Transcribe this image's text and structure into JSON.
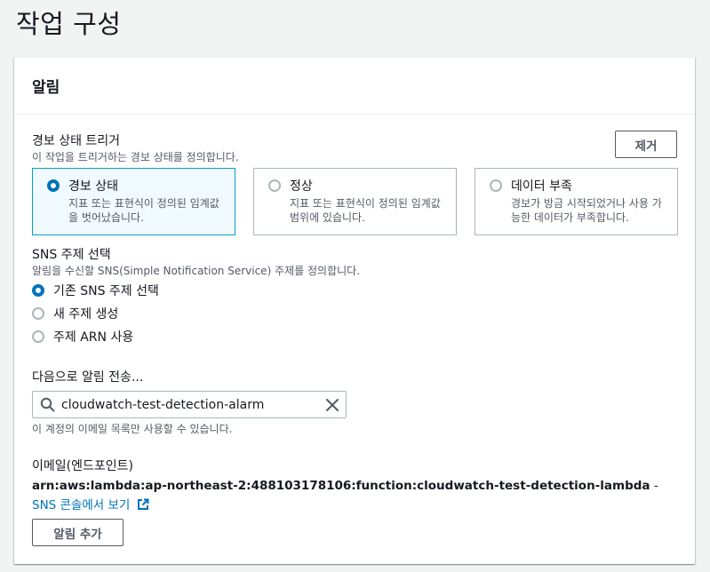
{
  "page": {
    "title": "작업 구성"
  },
  "panel": {
    "title": "알림",
    "remove_label": "제거"
  },
  "trigger": {
    "label": "경보 상태 트리거",
    "description": "이 작업을 트리거하는 경보 상태를 정의합니다.",
    "options": [
      {
        "title": "경보 상태",
        "desc": "지표 또는 표현식이 정의된 임계값을 벗어났습니다.",
        "selected": true
      },
      {
        "title": "정상",
        "desc": "지표 또는 표현식이 정의된 임계값 범위에 있습니다.",
        "selected": false
      },
      {
        "title": "데이터 부족",
        "desc": "경보가 방금 시작되었거나 사용 가능한 데이터가 부족합니다.",
        "selected": false
      }
    ]
  },
  "sns": {
    "label": "SNS 주제 선택",
    "description": "알림을 수신할 SNS(Simple Notification Service) 주제를 정의합니다.",
    "options": [
      {
        "label": "기존 SNS 주제 선택",
        "selected": true
      },
      {
        "label": "새 주제 생성",
        "selected": false
      },
      {
        "label": "주제 ARN 사용",
        "selected": false
      }
    ]
  },
  "send_to": {
    "label": "다음으로 알림 전송...",
    "value": "cloudwatch-test-detection-alarm",
    "hint": "이 계정의 이메일 목록만 사용할 수 있습니다."
  },
  "endpoint": {
    "label": "이메일(엔드포인트)",
    "arn": "arn:aws:lambda:ap-northeast-2:488103178106:function:cloudwatch-test-detection-lambda",
    "separator": " - ",
    "console_link": "SNS 콘솔에서 보기"
  },
  "add_label": "알림 추가",
  "colors": {
    "accent": "#0073bb",
    "selected_border": "#00a1c9",
    "selected_bg": "#f1faff",
    "page_bg": "#f2f3f3"
  }
}
